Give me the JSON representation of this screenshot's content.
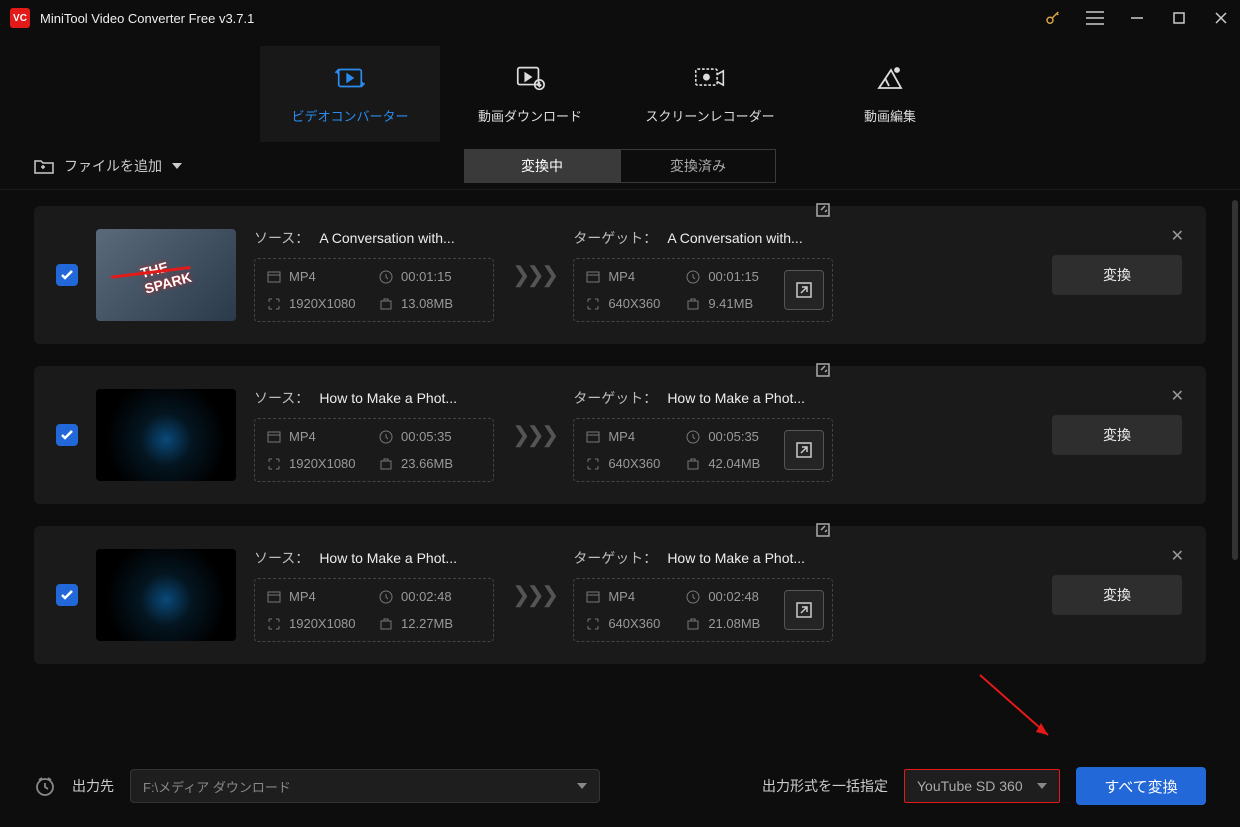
{
  "app": {
    "title": "MiniTool Video Converter Free v3.7.1"
  },
  "tabs": [
    {
      "label": "ビデオコンバーター"
    },
    {
      "label": "動画ダウンロード"
    },
    {
      "label": "スクリーンレコーダー"
    },
    {
      "label": "動画編集"
    }
  ],
  "toolbar": {
    "add_file": "ファイルを追加"
  },
  "status_tabs": {
    "converting": "変換中",
    "converted": "変換済み"
  },
  "labels": {
    "source": "ソース：",
    "target": "ターゲット："
  },
  "items": [
    {
      "source_name": "A Conversation with...",
      "src": {
        "fmt": "MP4",
        "dur": "00:01:15",
        "res": "1920X1080",
        "size": "13.08MB"
      },
      "target_name": "A Conversation with...",
      "tgt": {
        "fmt": "MP4",
        "dur": "00:01:15",
        "res": "640X360",
        "size": "9.41MB"
      },
      "btn": "変換"
    },
    {
      "source_name": "How to Make a Phot...",
      "src": {
        "fmt": "MP4",
        "dur": "00:05:35",
        "res": "1920X1080",
        "size": "23.66MB"
      },
      "target_name": "How to Make a Phot...",
      "tgt": {
        "fmt": "MP4",
        "dur": "00:05:35",
        "res": "640X360",
        "size": "42.04MB"
      },
      "btn": "変換"
    },
    {
      "source_name": "How to Make a Phot...",
      "src": {
        "fmt": "MP4",
        "dur": "00:02:48",
        "res": "1920X1080",
        "size": "12.27MB"
      },
      "target_name": "How to Make a Phot...",
      "tgt": {
        "fmt": "MP4",
        "dur": "00:02:48",
        "res": "640X360",
        "size": "21.08MB"
      },
      "btn": "変換"
    }
  ],
  "footer": {
    "output_label": "出力先",
    "output_path": "F:\\メディア ダウンロード",
    "format_label": "出力形式を一括指定",
    "format_value": "YouTube SD 360",
    "convert_all": "すべて変換"
  }
}
